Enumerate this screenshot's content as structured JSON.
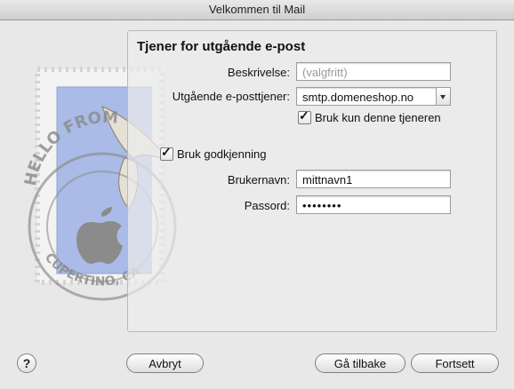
{
  "window": {
    "title": "Velkommen til Mail"
  },
  "stamp": {
    "text_top": "HELLO FROM",
    "text_bottom": "CUPERTINO, CA"
  },
  "form": {
    "heading": "Tjener for utgående e-post",
    "description_label": "Beskrivelse:",
    "description_placeholder": "(valgfritt)",
    "description_value": "",
    "server_label": "Utgående e-posttjener:",
    "server_value": "smtp.domeneshop.no",
    "only_this_server_label": "Bruk kun denne tjeneren",
    "only_this_server_checked": true,
    "use_auth_label": "Bruk godkjenning",
    "use_auth_checked": true,
    "username_label": "Brukernavn:",
    "username_value": "mittnavn1",
    "password_label": "Passord:",
    "password_value": "••••••••"
  },
  "buttons": {
    "help": "?",
    "cancel": "Avbryt",
    "back": "Gå tilbake",
    "continue": "Fortsett"
  },
  "colors": {
    "envelope_blue": "#9fb3e0",
    "stamp_paper": "#f2f2f2",
    "postmark": "#8a8a8a"
  }
}
